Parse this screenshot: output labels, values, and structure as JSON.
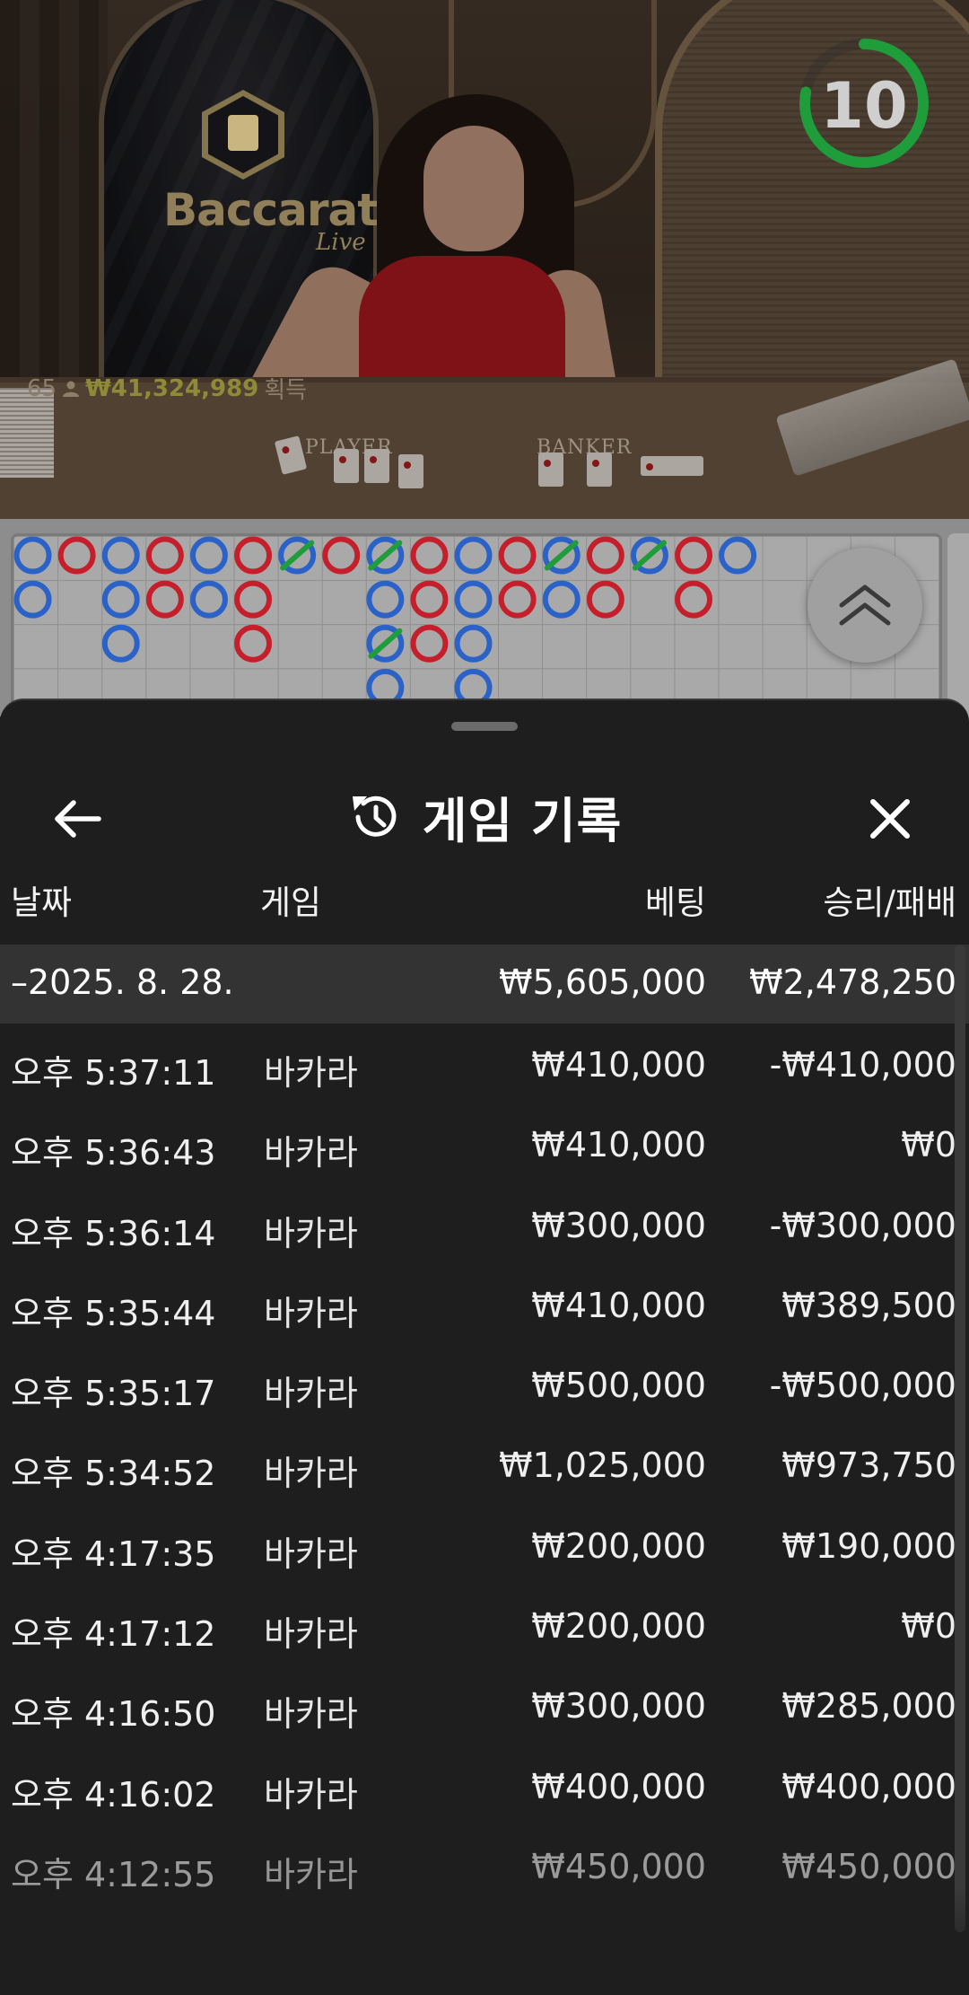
{
  "video": {
    "logo_title": "Baccarat",
    "logo_sub": "Live",
    "table_player_label": "PLAYER",
    "table_banker_label": "BANKER",
    "viewer_count": "65",
    "jackpot_amount": "₩41,324,989",
    "jackpot_suffix": "획득",
    "timer": "10",
    "timer_progress": 0.78,
    "accent_color": "#1f9d3a"
  },
  "roadmap": {
    "colors": {
      "player": "#2b62c8",
      "banker": "#c41f2a",
      "tie": "#1f9d3a"
    }
  },
  "sheet": {
    "title": "게임 기록",
    "columns": {
      "date": "날짜",
      "game": "게임",
      "bet": "베팅",
      "result": "승리/패배"
    },
    "summary": {
      "date": "–2025. 8. 28.",
      "bet": "₩5,605,000",
      "result": "₩2,478,250"
    },
    "rows": [
      {
        "time": "오후 5:37:11",
        "game": "바카라",
        "bet": "₩410,000",
        "result": "-₩410,000"
      },
      {
        "time": "오후 5:36:43",
        "game": "바카라",
        "bet": "₩410,000",
        "result": "₩0"
      },
      {
        "time": "오후 5:36:14",
        "game": "바카라",
        "bet": "₩300,000",
        "result": "-₩300,000"
      },
      {
        "time": "오후 5:35:44",
        "game": "바카라",
        "bet": "₩410,000",
        "result": "₩389,500"
      },
      {
        "time": "오후 5:35:17",
        "game": "바카라",
        "bet": "₩500,000",
        "result": "-₩500,000"
      },
      {
        "time": "오후 5:34:52",
        "game": "바카라",
        "bet": "₩1,025,000",
        "result": "₩973,750"
      },
      {
        "time": "오후 4:17:35",
        "game": "바카라",
        "bet": "₩200,000",
        "result": "₩190,000"
      },
      {
        "time": "오후 4:17:12",
        "game": "바카라",
        "bet": "₩200,000",
        "result": "₩0"
      },
      {
        "time": "오후 4:16:50",
        "game": "바카라",
        "bet": "₩300,000",
        "result": "₩285,000"
      },
      {
        "time": "오후 4:16:02",
        "game": "바카라",
        "bet": "₩400,000",
        "result": "₩400,000"
      },
      {
        "time": "오후 4:12:55",
        "game": "바카라",
        "bet": "₩450,000",
        "result": "₩450,000"
      }
    ]
  }
}
